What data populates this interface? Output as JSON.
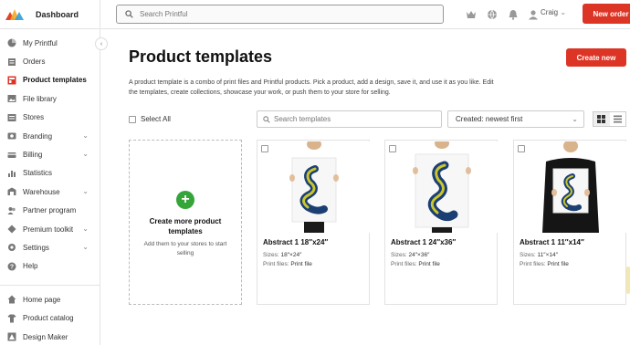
{
  "brand": {
    "title": "Dashboard"
  },
  "sidebar": {
    "items": [
      {
        "label": "My Printful",
        "icon": "pie-chart-icon"
      },
      {
        "label": "Orders",
        "icon": "list-icon"
      },
      {
        "label": "Product templates",
        "icon": "templates-icon",
        "active": true
      },
      {
        "label": "File library",
        "icon": "image-icon"
      },
      {
        "label": "Stores",
        "icon": "store-icon"
      },
      {
        "label": "Branding",
        "icon": "branding-icon",
        "expandable": true
      },
      {
        "label": "Billing",
        "icon": "billing-icon",
        "expandable": true
      },
      {
        "label": "Statistics",
        "icon": "bar-chart-icon"
      },
      {
        "label": "Warehouse",
        "icon": "warehouse-icon",
        "expandable": true
      },
      {
        "label": "Partner program",
        "icon": "partner-icon"
      },
      {
        "label": "Premium toolkit",
        "icon": "toolkit-icon",
        "expandable": true
      },
      {
        "label": "Settings",
        "icon": "gear-icon",
        "expandable": true
      },
      {
        "label": "Help",
        "icon": "help-icon"
      }
    ],
    "bottom_items": [
      {
        "label": "Home page",
        "icon": "home-icon"
      },
      {
        "label": "Product catalog",
        "icon": "shirt-icon"
      },
      {
        "label": "Design Maker",
        "icon": "design-icon"
      }
    ]
  },
  "topbar": {
    "search_placeholder": "Search Printful",
    "user_name": "Craig",
    "new_order_label": "New order"
  },
  "main": {
    "title": "Product templates",
    "create_new_label": "Create new",
    "description": "A product template is a combo of print files and Printful products. Pick a product, add a design, save it, and use it as you like. Edit the templates, create collections, showcase your work, or push them to your store for selling.",
    "select_all_label": "Select All",
    "search_placeholder": "Search templates",
    "sort_value": "Created: newest first",
    "create_card": {
      "title": "Create more product templates",
      "subtitle": "Add them to your stores to start selling"
    },
    "templates": [
      {
        "name": "Abstract 1 18″x24″",
        "sizes_label": "Sizes:",
        "sizes": "18″×24″",
        "files_label": "Print files:",
        "files": "Print file"
      },
      {
        "name": "Abstract 1 24″x36″",
        "sizes_label": "Sizes:",
        "sizes": "24″×36″",
        "files_label": "Print files:",
        "files": "Print file"
      },
      {
        "name": "Abstract 1 11″x14″",
        "sizes_label": "Sizes:",
        "sizes": "11″×14″",
        "files_label": "Print files:",
        "files": "Print file"
      }
    ]
  },
  "colors": {
    "accent_red": "#dc3526",
    "plus_green": "#36a539",
    "logo": [
      "#e0452b",
      "#f5a623",
      "#2f9fd8"
    ]
  }
}
